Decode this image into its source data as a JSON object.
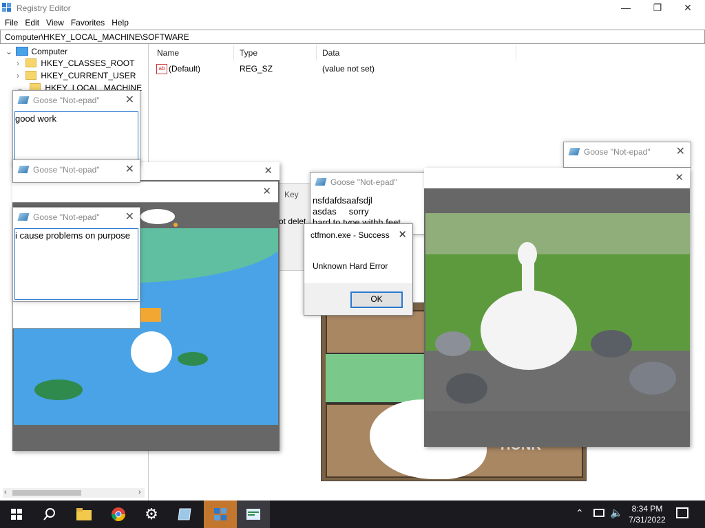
{
  "window": {
    "title": "Registry Editor",
    "minimize": "—",
    "maximize": "❐",
    "close": "✕"
  },
  "menu": [
    "File",
    "Edit",
    "View",
    "Favorites",
    "Help"
  ],
  "address": "Computer\\HKEY_LOCAL_MACHINE\\SOFTWARE",
  "tree": {
    "root": "Computer",
    "items": [
      "HKEY_CLASSES_ROOT",
      "HKEY_CURRENT_USER",
      "HKEY_LOCAL_MACHINE"
    ]
  },
  "list": {
    "headers": [
      "Name",
      "Type",
      "Data"
    ],
    "rows": [
      {
        "name": "(Default)",
        "type": "REG_SZ",
        "data": "(value not set)"
      }
    ]
  },
  "notepads": [
    {
      "title": "Goose \"Not-epad\"",
      "text": "good work"
    },
    {
      "title": "Goose \"Not-epad\"",
      "text": ""
    },
    {
      "title": "Goose \"Not-epad\"",
      "text": "i cause problems on purpose"
    },
    {
      "title": "Goose \"Not-epad\"",
      "text": "nsfdafdsaafsdjl\nasdas     sorry\nhard to type withh feet"
    },
    {
      "title": "Goose \"Not-epad\"",
      "text": ""
    }
  ],
  "dialog": {
    "title": "ctfmon.exe - Success",
    "message": "Unknown Hard Error",
    "ok": "OK"
  },
  "partial_texts": {
    "key": "Key",
    "delete": "ot delet",
    "honk": "HONK"
  },
  "taskbar": {
    "time": "8:34 PM",
    "date": "7/31/2022",
    "icons": [
      "windows-start-icon",
      "search-icon",
      "file-explorer-icon",
      "chrome-icon",
      "settings-icon",
      "notepad-icon",
      "registry-editor-icon",
      "goose-notepad-icon"
    ]
  },
  "colors": {
    "taskbar": "#1a1a1f",
    "accent": "#2a78d0",
    "pond": "#4aa3e6",
    "grass": "#7ac98a"
  }
}
